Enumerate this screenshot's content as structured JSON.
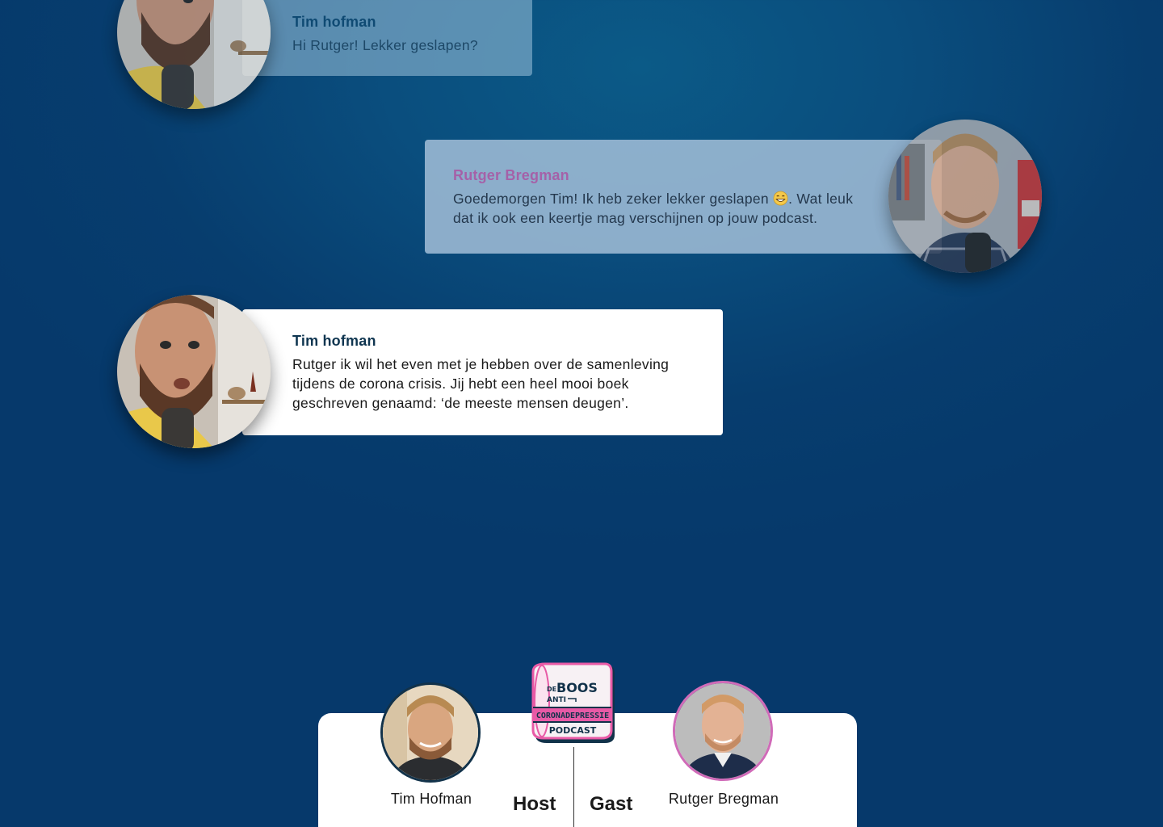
{
  "chat": [
    {
      "author": "Tim hofman",
      "message": "Hi Rutger! Lekker geslapen?"
    },
    {
      "author": "Rutger Bregman",
      "message_before_emoji": "Goedemorgen Tim! Ik heb zeker lekker geslapen ",
      "emoji": "grinning-face-emoji",
      "message_after_emoji": ". Wat leuk dat ik ook een keertje mag verschijnen op jouw podcast."
    },
    {
      "author": "Tim hofman",
      "message": "Rutger ik wil het even met je hebben over de samenleving tijdens de corona crisis. Jij hebt een heel mooi boek geschreven genaamd: ‘de meeste mensen deugen’."
    }
  ],
  "footer": {
    "host_name": "Tim Hofman",
    "host_label": "Host",
    "guest_label": "Gast",
    "guest_name": "Rutger Bregman",
    "logo": {
      "line1_small": "DE",
      "line1": "BOOS",
      "line2": "ANTI",
      "line3": "CORONADEPRESSIE",
      "line4": "PODCAST"
    }
  },
  "colors": {
    "background": "#073d6e",
    "host_accent": "#12324a",
    "guest_accent": "#d06bb8",
    "guest_name_color": "#a561a8",
    "logo_pink": "#e85aa6"
  }
}
